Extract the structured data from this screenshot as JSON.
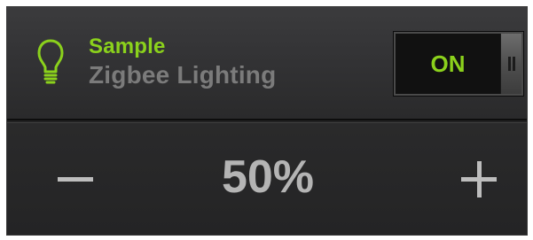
{
  "device": {
    "title": "Sample",
    "subtitle": "Zigbee Lighting"
  },
  "power_toggle": {
    "label": "ON",
    "state": "on"
  },
  "brightness": {
    "value_text": "50%",
    "value": 50
  },
  "icons": {
    "device": "lightbulb-icon",
    "decrease": "minus-icon",
    "increase": "plus-icon"
  },
  "colors": {
    "accent": "#8bd11c",
    "subtitle": "#7b7b7b",
    "value": "#b4b4b4",
    "background": "#222223"
  }
}
